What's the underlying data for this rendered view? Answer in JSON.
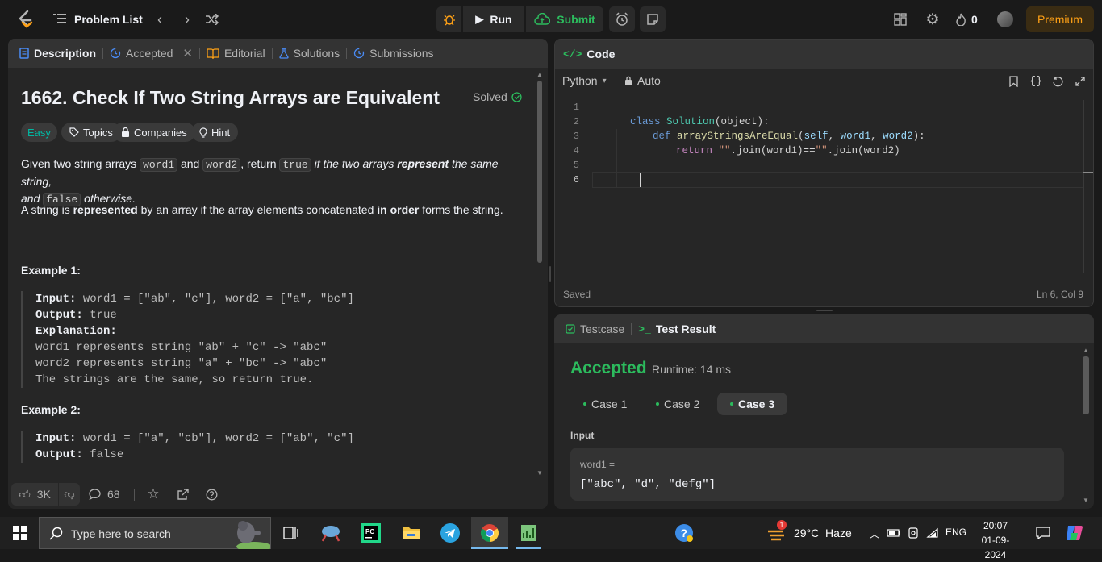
{
  "topbar": {
    "problem_list": "Problem List",
    "run": "Run",
    "submit": "Submit",
    "streak": "0",
    "premium": "Premium"
  },
  "left_tabs": {
    "description": "Description",
    "accepted": "Accepted",
    "editorial": "Editorial",
    "solutions": "Solutions",
    "submissions": "Submissions"
  },
  "problem": {
    "title": "1662. Check If Two String Arrays are Equivalent",
    "solved": "Solved",
    "difficulty": "Easy",
    "topics": "Topics",
    "companies": "Companies",
    "hint": "Hint",
    "p1_a": "Given two string arrays ",
    "p1_word1": "word1",
    "p1_and": " and ",
    "p1_word2": "word2",
    "p1_return": ", return ",
    "p1_true": "true",
    "p1_if": " if the two arrays ",
    "p1_represent": "represent",
    "p1_same": " the same string,",
    "p1_and2": "and ",
    "p1_false": "false",
    "p1_otherwise": " otherwise.",
    "p2_a": "A string is ",
    "p2_represented": "represented",
    "p2_b": " by an array if the array elements concatenated ",
    "p2_inorder": "in order",
    "p2_c": " forms the string.",
    "example1_title": "Example 1:",
    "ex1_input_label": "Input:",
    "ex1_input": " word1 = [\"ab\", \"c\"], word2 = [\"a\", \"bc\"]",
    "ex1_output_label": "Output:",
    "ex1_output": " true",
    "ex1_expl_label": "Explanation:",
    "ex1_expl1": "word1 represents string \"ab\" + \"c\" -> \"abc\"",
    "ex1_expl2": "word2 represents string \"a\" + \"bc\" -> \"abc\"",
    "ex1_expl3": "The strings are the same, so return true.",
    "example2_title": "Example 2:",
    "ex2_input_label": "Input:",
    "ex2_input": " word1 = [\"a\", \"cb\"], word2 = [\"ab\", \"c\"]",
    "ex2_output_label": "Output:",
    "ex2_output": " false"
  },
  "left_footer": {
    "likes": "3K",
    "comments": "68"
  },
  "code_panel": {
    "title": "Code",
    "language": "Python",
    "auto": "Auto",
    "status": "Saved",
    "cursor": "Ln 6, Col 9",
    "line_numbers": [
      "1",
      "2",
      "3",
      "4",
      "5",
      "6"
    ],
    "l1_kw": "class ",
    "l1_name": "Solution",
    "l1_rest": "(object):",
    "l2_kw": "def ",
    "l2_name": "arrayStringsAreEqual",
    "l2_p1": "(",
    "l2_self": "self",
    "l2_p2": ", ",
    "l2_w1": "word1",
    "l2_p3": ", ",
    "l2_w2": "word2",
    "l2_p4": "):",
    "l3_kw": "return ",
    "l3_s1": "\"\"",
    "l3_mid": ".join(word1)==",
    "l3_s2": "\"\"",
    "l3_end": ".join(word2)"
  },
  "result_panel": {
    "testcase": "Testcase",
    "test_result": "Test Result",
    "verdict": "Accepted",
    "runtime": "Runtime: 14 ms",
    "cases": [
      "Case 1",
      "Case 2",
      "Case 3"
    ],
    "input_label": "Input",
    "var_label": "word1 =",
    "var_value": "[\"abc\", \"d\", \"defg\"]"
  },
  "taskbar": {
    "search_placeholder": "Type here to search",
    "weather": "29°C  Haze",
    "lang": "ENG",
    "time": "20:07",
    "date": "01-09-2024",
    "weather_badge": "1"
  },
  "colors": {
    "accent_orange": "#ffa116",
    "green": "#2cbb5d",
    "easy": "#00b8a3",
    "blue": "#4a8cf7"
  }
}
